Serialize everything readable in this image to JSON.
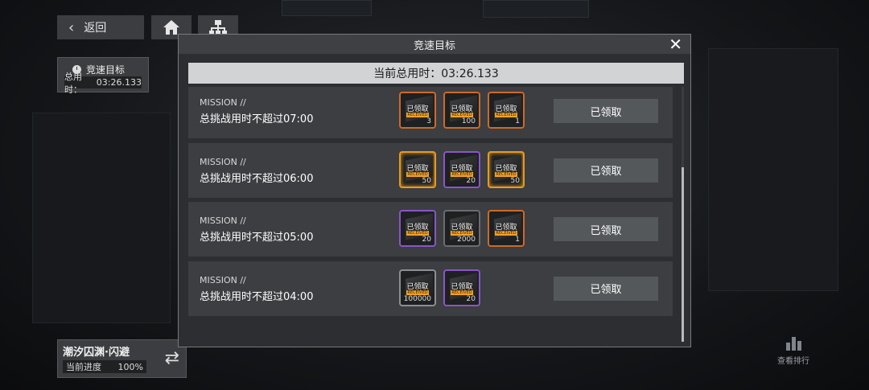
{
  "header": {
    "back_label": "返回",
    "home_icon": "home-icon",
    "tree_icon": "hierarchy-icon"
  },
  "speed_panel": {
    "title": "竞速目标",
    "time_label": "总用时：",
    "time_value": "03:26.133"
  },
  "stage": {
    "title": "潮汐囚渊·闪避",
    "progress_label": "当前进度",
    "progress_value": "100%"
  },
  "rank": {
    "label": "查看排行"
  },
  "modal": {
    "title": "竞速目标",
    "total_time": "当前总用时：03:26.133",
    "claimed_label": "已领取",
    "received_text": "RECEIVED"
  },
  "missions": [
    {
      "label": "MISSION //",
      "desc": "总挑战用时不超过07:00",
      "button": "已领取",
      "rewards": [
        {
          "style": "orange",
          "count": "3"
        },
        {
          "style": "orange",
          "count": "100"
        },
        {
          "style": "orange",
          "count": "1"
        }
      ]
    },
    {
      "label": "MISSION //",
      "desc": "总挑战用时不超过06:00",
      "button": "已领取",
      "rewards": [
        {
          "style": "gold",
          "count": "50"
        },
        {
          "style": "purple",
          "count": "20"
        },
        {
          "style": "gold",
          "count": "50"
        }
      ]
    },
    {
      "label": "MISSION //",
      "desc": "总挑战用时不超过05:00",
      "button": "已领取",
      "rewards": [
        {
          "style": "purple",
          "count": "20"
        },
        {
          "style": "gray",
          "count": "2000"
        },
        {
          "style": "orange",
          "count": "1"
        }
      ]
    },
    {
      "label": "MISSION //",
      "desc": "总挑战用时不超过04:00",
      "button": "已领取",
      "rewards": [
        {
          "style": "silver",
          "count": "100000"
        },
        {
          "style": "purple",
          "count": "20"
        }
      ]
    }
  ]
}
